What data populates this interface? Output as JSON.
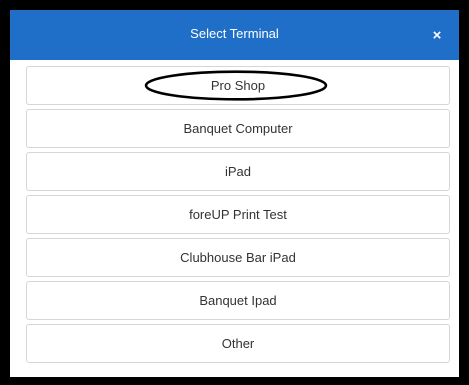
{
  "modal": {
    "title": "Select Terminal",
    "close_label": "×",
    "header_color": "#1f6ec7"
  },
  "terminals": [
    {
      "label": "Pro Shop",
      "annotated": true
    },
    {
      "label": "Banquet Computer"
    },
    {
      "label": "iPad"
    },
    {
      "label": "foreUP Print Test"
    },
    {
      "label": "Clubhouse Bar iPad"
    },
    {
      "label": "Banquet Ipad"
    },
    {
      "label": "Other"
    }
  ]
}
